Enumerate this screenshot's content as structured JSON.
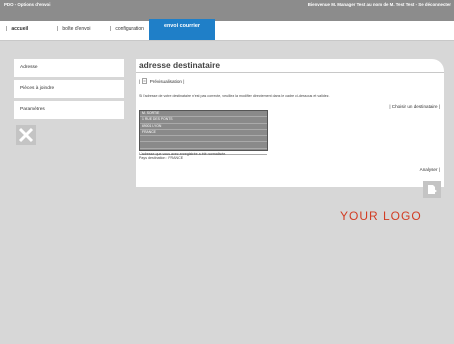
{
  "window": {
    "title": "PDO - Options d'envoi",
    "welcome": "Bienvenue M. Manager Test au nom de M. Test Test - Se déconnecter"
  },
  "tabs": {
    "accueil": "accueil",
    "boite": "boîte d'envoi",
    "config": "configuration",
    "active": "envoi courrier",
    "sep": "|"
  },
  "sidebar": {
    "items": [
      {
        "label": "Adresse"
      },
      {
        "label": "Pièces à joindre"
      },
      {
        "label": "Paramètres"
      }
    ]
  },
  "panel": {
    "title": "adresse destinataire",
    "preview": "Prévisualisation",
    "info": "Si l'adresse de votre destinataire n'est pas correcte, veuillez la modifier directement dans le cadre ci-dessous et validez.",
    "choose": "Choisir un destinataire",
    "address_lines": [
      "M. SORTIE",
      "1 RUE DES PONTS",
      "69001 LYON",
      "FRANCE",
      "",
      "",
      ""
    ],
    "normalized": "L'adresse que vous avez enregistrée a été normalisée.",
    "country": "Pays destination : FRANCE",
    "analyze": "Analyser"
  },
  "logo": "YOUR LOGO",
  "icons": {
    "close": "close-icon",
    "next": "document-arrow-icon",
    "preview": "document-icon"
  },
  "colors": {
    "accent": "#1f7fc8",
    "logo": "#d23c23",
    "titlebar": "#8c8c8c",
    "background": "#d7d7d7"
  }
}
